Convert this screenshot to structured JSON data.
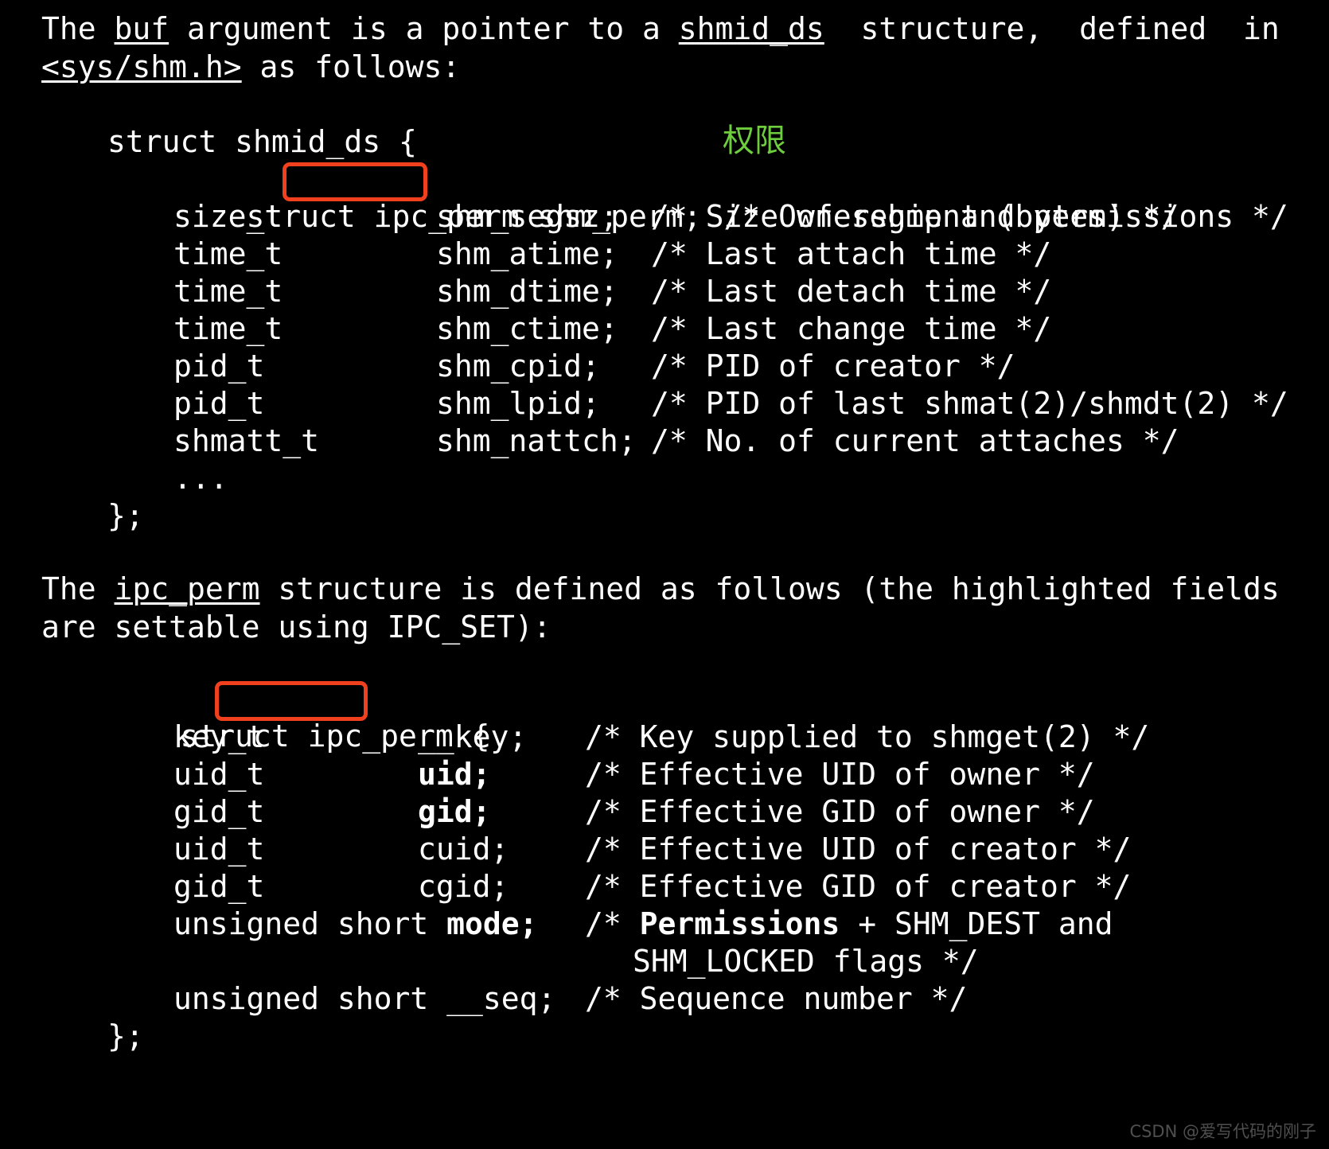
{
  "theme": {
    "background": "#000000",
    "foreground": "#ffffff",
    "annotation_box_color": "#F0401E",
    "annotation_text_color": "#6ECC3F",
    "watermark_color": "#4f4f4f"
  },
  "intro": {
    "line1_part1": "The ",
    "line1_underlined": "buf",
    "line1_part2": " argument is a pointer to a ",
    "line1_underlined2": "shmid_ds",
    "line1_part3": "  structure,  defined  in",
    "line2_underlined": "<sys/shm.h>",
    "line2_part2": " as follows:"
  },
  "struct1": {
    "header": "struct shmid_ds {",
    "open_type_prefix": "struct ",
    "open_type_boxed": "ipc_perm",
    "open_field": "shm_perm;",
    "rows": [
      {
        "type": "size_t",
        "field": "shm_segsz;",
        "comment": "/* Size of segment (bytes) */"
      },
      {
        "type": "time_t",
        "field": "shm_atime;",
        "comment": "/* Last attach time */"
      },
      {
        "type": "time_t",
        "field": "shm_dtime;",
        "comment": "/* Last detach time */"
      },
      {
        "type": "time_t",
        "field": "shm_ctime;",
        "comment": "/* Last change time */"
      },
      {
        "type": "pid_t",
        "field": "shm_cpid;",
        "comment": "/* PID of creator */"
      },
      {
        "type": "pid_t",
        "field": "shm_lpid;",
        "comment": "/* PID of last shmat(2)/shmdt(2) */"
      },
      {
        "type": "shmatt_t",
        "field": "shm_nattch;",
        "comment": "/* No. of current attaches */"
      }
    ],
    "first_comment": "/* Ownership and permissions */",
    "ellipsis": "...",
    "close": "};",
    "annotation_cjk": "权限"
  },
  "bridge": {
    "line1_part1": "The ",
    "line1_underlined": "ipc_perm",
    "line1_part2": " structure is defined as follows (the highlighted fields",
    "line2": "are settable using IPC_SET):"
  },
  "struct2": {
    "header_prefix": "struct ",
    "header_boxed": "ipc_perm",
    "header_suffix": "{",
    "rows": [
      {
        "type": "key_t",
        "field": "__key;",
        "bold": false,
        "comment_plain": "/* Key supplied to shmget(2) */",
        "comment_bold": ""
      },
      {
        "type": "uid_t",
        "field": "uid;",
        "bold": true,
        "comment_plain": "/* Effective UID of owner */",
        "comment_bold": ""
      },
      {
        "type": "gid_t",
        "field": "gid;",
        "bold": true,
        "comment_plain": "/* Effective GID of owner */",
        "comment_bold": ""
      },
      {
        "type": "uid_t",
        "field": "cuid;",
        "bold": false,
        "comment_plain": "/* Effective UID of creator */",
        "comment_bold": ""
      },
      {
        "type": "gid_t",
        "field": "cgid;",
        "bold": false,
        "comment_plain": "/* Effective GID of creator */",
        "comment_bold": ""
      }
    ],
    "mode_type": "unsigned short ",
    "mode_field": "mode;",
    "mode_comment_prefix": "/* ",
    "mode_comment_bold": "Permissions",
    "mode_comment_suffix": " + SHM_DEST and",
    "mode_comment_line2": "SHM_LOCKED flags */",
    "seq_type": "unsigned short ",
    "seq_field": "__seq;",
    "seq_comment": "/* Sequence number */",
    "close": "};"
  },
  "watermark": {
    "text": "CSDN @爱写代码的刚子"
  }
}
